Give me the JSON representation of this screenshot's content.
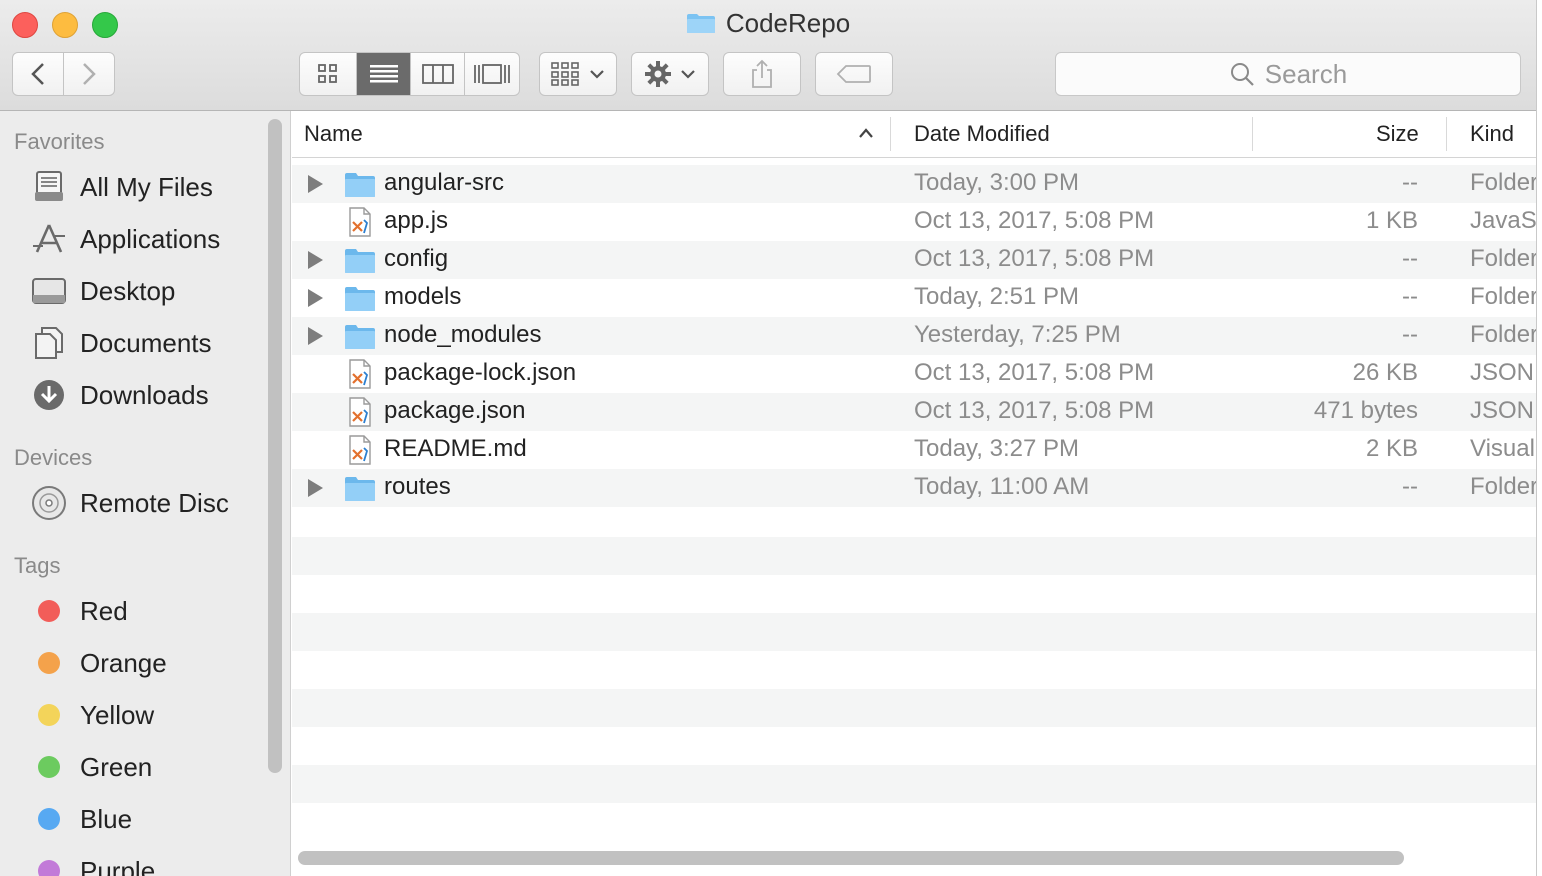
{
  "window": {
    "title": "CodeRepo"
  },
  "search": {
    "placeholder": "Search"
  },
  "sidebar": {
    "favorites_header": "Favorites",
    "favorites": [
      {
        "label": "All My Files",
        "icon": "all-files-icon"
      },
      {
        "label": "Applications",
        "icon": "applications-icon"
      },
      {
        "label": "Desktop",
        "icon": "desktop-icon"
      },
      {
        "label": "Documents",
        "icon": "documents-icon"
      },
      {
        "label": "Downloads",
        "icon": "downloads-icon"
      }
    ],
    "devices_header": "Devices",
    "devices": [
      {
        "label": "Remote Disc",
        "icon": "disc-icon"
      }
    ],
    "tags_header": "Tags",
    "tags": [
      {
        "label": "Red",
        "color": "#f25d59"
      },
      {
        "label": "Orange",
        "color": "#f4a24b"
      },
      {
        "label": "Yellow",
        "color": "#f3d45a"
      },
      {
        "label": "Green",
        "color": "#6ccb5f"
      },
      {
        "label": "Blue",
        "color": "#57a9f2"
      },
      {
        "label": "Purple",
        "color": "#c27ad8"
      }
    ]
  },
  "columns": {
    "name": "Name",
    "date": "Date Modified",
    "size": "Size",
    "kind": "Kind"
  },
  "files": [
    {
      "name": "angular-src",
      "date": "Today, 3:00 PM",
      "size": "--",
      "kind": "Folder",
      "type": "folder"
    },
    {
      "name": "app.js",
      "date": "Oct 13, 2017, 5:08 PM",
      "size": "1 KB",
      "kind": "JavaScript",
      "type": "file"
    },
    {
      "name": "config",
      "date": "Oct 13, 2017, 5:08 PM",
      "size": "--",
      "kind": "Folder",
      "type": "folder"
    },
    {
      "name": "models",
      "date": "Today, 2:51 PM",
      "size": "--",
      "kind": "Folder",
      "type": "folder"
    },
    {
      "name": "node_modules",
      "date": "Yesterday, 7:25 PM",
      "size": "--",
      "kind": "Folder",
      "type": "folder"
    },
    {
      "name": "package-lock.json",
      "date": "Oct 13, 2017, 5:08 PM",
      "size": "26 KB",
      "kind": "JSON",
      "type": "file"
    },
    {
      "name": "package.json",
      "date": "Oct 13, 2017, 5:08 PM",
      "size": "471 bytes",
      "kind": "JSON",
      "type": "file"
    },
    {
      "name": "README.md",
      "date": "Today, 3:27 PM",
      "size": "2 KB",
      "kind": "Visual",
      "type": "file"
    },
    {
      "name": "routes",
      "date": "Today, 11:00 AM",
      "size": "--",
      "kind": "Folder",
      "type": "folder"
    }
  ]
}
